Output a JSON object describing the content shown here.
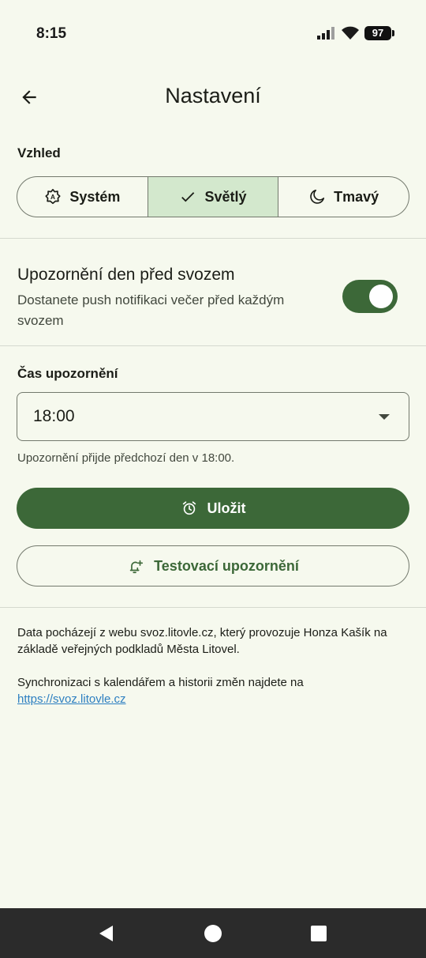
{
  "status_bar": {
    "time": "8:15",
    "battery": "97"
  },
  "app_bar": {
    "title": "Nastavení"
  },
  "appearance": {
    "label": "Vzhled",
    "options": [
      {
        "label": "Systém",
        "icon": "auto-brightness-icon",
        "selected": false
      },
      {
        "label": "Světlý",
        "icon": "check-icon",
        "selected": true
      },
      {
        "label": "Tmavý",
        "icon": "moon-icon",
        "selected": false
      }
    ]
  },
  "notification": {
    "title": "Upozornění den před svozem",
    "description": "Dostanete push notifikaci večer před každým svozem",
    "enabled": true
  },
  "notify_time": {
    "label": "Čas upozornění",
    "value": "18:00",
    "helper": "Upozornění přijde předchozí den v 18:00."
  },
  "buttons": {
    "save": "Uložit",
    "test": "Testovací upozornění"
  },
  "info": {
    "source": "Data pocházejí z webu svoz.litovle.cz, který provozuje Honza Kašík na základě veřejných podkladů Města Litovel.",
    "sync_prefix": "Synchronizaci s kalendářem a historii změn najdete na ",
    "sync_link": "https://svoz.litovle.cz"
  },
  "colors": {
    "primary": "#3c6838",
    "selected_segment": "#d3e8cd",
    "background": "#f6f9ee",
    "link": "#2d7fc1"
  }
}
